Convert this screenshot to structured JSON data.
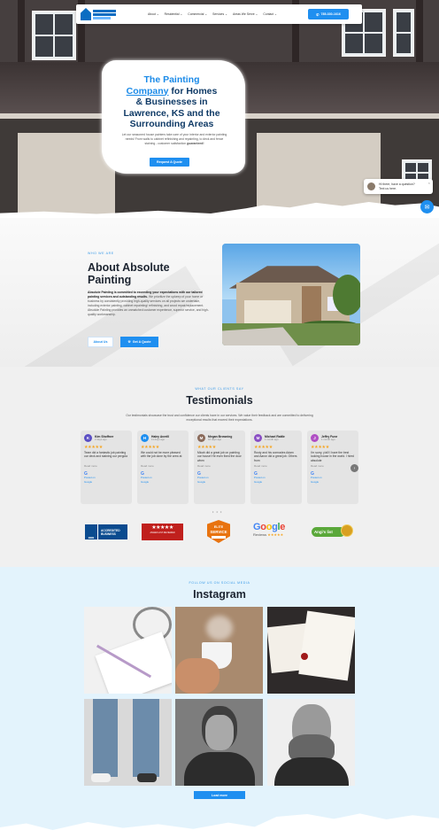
{
  "nav": {
    "menu": [
      "About",
      "Residential",
      "Commercial",
      "Services",
      "Areas We Serve",
      "Contact"
    ],
    "phone": "785-330-1616",
    "colors": {
      "accent": "#1f8ff0",
      "brand_dark": "#0a4b8f"
    }
  },
  "hero": {
    "title_line1": "The Painting",
    "title_line2_link": "Company",
    "title_line2_rest": " for Homes",
    "title_line3": "& Businesses in",
    "title_line4": "Lawrence, KS and the",
    "title_line5": "Surrounding Areas",
    "subtitle": "Let our seasoned house painters take care of your interior and exterior painting needs! From walls to cabinet refinishing and repainting, to deck and fence staining - customer satisfaction",
    "subtitle_bold": "guaranteed!",
    "cta": "Request A Quote"
  },
  "chat": {
    "line1": "Hi there, have a question?",
    "line2": "Text us here.",
    "close": "×"
  },
  "about": {
    "kicker": "WHO WE ARE",
    "title": "About Absolute Painting",
    "body_bold": "Absolute Painting is committed to exceeding your expectations with our tailored painting services and outstanding results.",
    "body": " We prioritize the upkeep of your home or business by consistently providing high-quality services on all projects we undertake, including exterior painting, cabinet repainting/ refinishing, and wood repair/replacement. Absolute Painting provides an unmatched customer experience, superior service, and high-quality workmanship.",
    "btn_us": "About Us",
    "btn_quote": "Get A Quote"
  },
  "testimonials": {
    "kicker": "WHAT OUR CLIENTS SAY",
    "title": "Testimonials",
    "intro": "Our testimonials showcase the trust and confidence our clients have in our services. We value their feedback and are committed to delivering exceptional results that exceed their expectations.",
    "reviews": [
      {
        "initial": "K",
        "name": "Kim Shoffner",
        "ago": "2 days ago",
        "stars": "★★★★★",
        "text": "Team did a fantastic job painting our deck and staining our pergola",
        "color": "#5b4fc4"
      },
      {
        "initial": "H",
        "name": "Haley Averill",
        "ago": "11 days ago",
        "stars": "★★★★★",
        "text": "We could not be more pleased with the job done by the crew at",
        "color": "#1f8ff0"
      },
      {
        "initial": "M",
        "name": "Megan Browning",
        "ago": "16 days ago",
        "stars": "★★★★★",
        "text": "Micah did a great job on painting our house! He even fixed the door when",
        "color": "#8a6a5a"
      },
      {
        "initial": "M",
        "name": "Michael Rattle",
        "ago": "1 month ago",
        "stars": "★★★★★",
        "text": "Rusty and his comrades Adam and Aaron did a great job. Others from",
        "color": "#8a4fc4"
      },
      {
        "initial": "J",
        "name": "Jeffry Fune",
        "ago": "1 month ago",
        "stars": "★★★★★",
        "text": "I'm sorry, y'all! I have the best looking house in the world. I hired absolute",
        "color": "#b04fc4"
      }
    ],
    "read_more": "Read more",
    "posted_on": "Posted on",
    "google": "Google",
    "dots": "• • •",
    "next_icon": "›"
  },
  "badges": {
    "bbb_seal": "BBB",
    "bbb": "ACCREDITED BUSINESS",
    "angi_stars": "★★★★★",
    "angi_line": "ANGIES LIST REVIEWED",
    "elite_top": "ELITE",
    "elite_main": "SERVICE",
    "google_word": "Google",
    "google_reviews": "Reviews",
    "google_stars": "★★★★★",
    "angis": "Angi's list"
  },
  "instagram": {
    "kicker": "FOLLOW US ON SOCIAL MEDIA",
    "title": "Instagram",
    "load_more": "Load more"
  }
}
